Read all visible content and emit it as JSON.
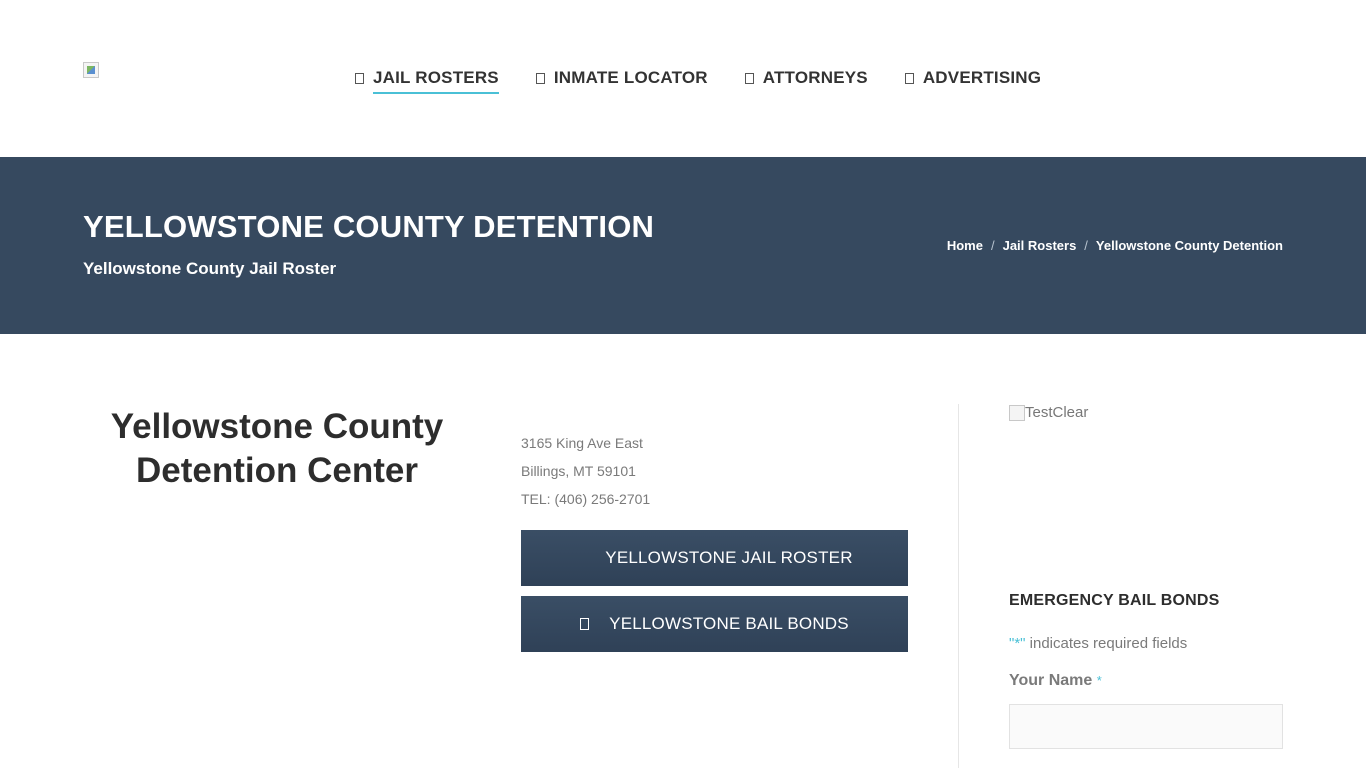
{
  "nav": {
    "items": [
      {
        "label": "JAIL ROSTERS",
        "icon": "list-icon",
        "active": true
      },
      {
        "label": "INMATE LOCATOR",
        "icon": "search-icon",
        "active": false
      },
      {
        "label": "ATTORNEYS",
        "icon": "gavel-icon",
        "active": false
      },
      {
        "label": "ADVERTISING",
        "icon": "bullhorn-icon",
        "active": false
      }
    ]
  },
  "titlebar": {
    "title": "YELLOWSTONE COUNTY DETENTION",
    "subtitle": "Yellowstone County Jail Roster",
    "breadcrumb": {
      "home": "Home",
      "sep": "/",
      "section": "Jail Rosters",
      "current": "Yellowstone County Detention"
    },
    "bg_color": "#36495f"
  },
  "facility": {
    "name": "Yellowstone County Detention Center",
    "address_line1": "3165 King Ave East",
    "address_line2": "Billings, MT 59101",
    "phone": "TEL: (406) 256-2701"
  },
  "buttons": {
    "roster": "YELLOWSTONE JAIL ROSTER",
    "bail": "YELLOWSTONE BAIL BONDS"
  },
  "sidebar": {
    "ad_alt": "TestClear",
    "title": "EMERGENCY BAIL BONDS",
    "required_star": "\"*\"",
    "required_text": " indicates required fields",
    "name_label": "Your Name",
    "name_req": "*",
    "name_value": ""
  },
  "colors": {
    "accent": "#4ac0d6",
    "button_bg": "#344760"
  }
}
